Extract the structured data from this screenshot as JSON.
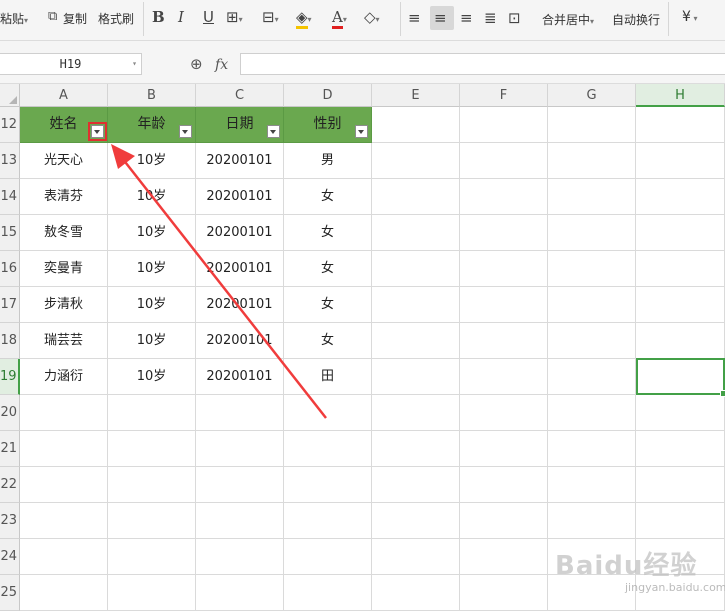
{
  "toolbar": {
    "paste_label": "粘贴",
    "copy_label": "复制",
    "format_painter_label": "格式刷",
    "merge_center_label": "合并居中",
    "wrap_text_label": "自动换行",
    "currency_symbol": "¥",
    "icons": [
      "paste-icon",
      "copy-icon",
      "format-painter-icon",
      "bold-icon",
      "italic-icon",
      "underline-icon",
      "border-icon",
      "fill-color-icon",
      "font-color-icon",
      "eraser-icon",
      "align-left-icon",
      "align-center-icon",
      "align-right-icon",
      "justify-icon",
      "distributed-icon"
    ]
  },
  "formula_bar": {
    "name_box_value": "H19",
    "fx_label": "fx",
    "formula_value": ""
  },
  "grid": {
    "columns": [
      "A",
      "B",
      "C",
      "D",
      "E",
      "F",
      "G",
      "H"
    ],
    "selected_column": "H",
    "rows": [
      "12",
      "13",
      "14",
      "15",
      "16",
      "17",
      "18",
      "19",
      "20",
      "21",
      "22",
      "23",
      "24",
      "25"
    ],
    "selected_row": "19",
    "header_row": [
      "姓名",
      "年龄",
      "日期",
      "性别"
    ],
    "data_rows": [
      [
        "光天心",
        "10岁",
        "20200101",
        "男"
      ],
      [
        "表清芬",
        "10岁",
        "20200101",
        "女"
      ],
      [
        "敖冬雪",
        "10岁",
        "20200101",
        "女"
      ],
      [
        "奕曼青",
        "10岁",
        "20200101",
        "女"
      ],
      [
        "步清秋",
        "10岁",
        "20200101",
        "女"
      ],
      [
        "瑞芸芸",
        "10岁",
        "20200101",
        "女"
      ],
      [
        "力涵衍",
        "10岁",
        "20200101",
        "田"
      ]
    ],
    "header_fill_color": "#6aa84f",
    "selection_color": "#43a047",
    "highlight_color": "#e03030"
  },
  "watermark": {
    "logo_text": "Baidu经验",
    "url_text": "jingyan.baidu.com"
  }
}
